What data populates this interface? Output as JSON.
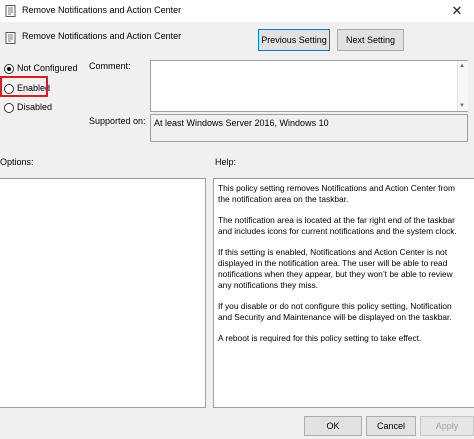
{
  "window": {
    "title": "Remove Notifications and Action Center",
    "close_glyph": "✕"
  },
  "policy": {
    "name": "Remove Notifications and Action Center",
    "icon": "policy-setting-icon"
  },
  "nav": {
    "previous_label": "Previous Setting",
    "next_label": "Next Setting"
  },
  "state": {
    "options": [
      {
        "label": "Not Configured",
        "selected": true
      },
      {
        "label": "Enabled",
        "selected": false,
        "highlighted": true
      },
      {
        "label": "Disabled",
        "selected": false
      }
    ],
    "highlight_color": "#d81b28"
  },
  "comment": {
    "label": "Comment:",
    "value": ""
  },
  "supported": {
    "label": "Supported on:",
    "value": "At least Windows Server 2016, Windows 10"
  },
  "options_panel": {
    "label": "Options:"
  },
  "help_panel": {
    "label": "Help:",
    "paragraphs": [
      "This policy setting removes Notifications and Action Center from the notification area on the taskbar.",
      "The notification area is located at the far right end of the taskbar and includes icons for current notifications and the system clock.",
      "If this setting is enabled, Notifications and Action Center is not displayed in the notification area. The user will be able to read notifications when they appear, but they won’t be able to review any notifications they miss.",
      "If you disable or do not configure this policy setting, Notification and Security and Maintenance will be displayed on the taskbar.",
      "A reboot is required for this policy setting to take effect."
    ]
  },
  "footer": {
    "ok_label": "OK",
    "cancel_label": "Cancel",
    "apply_label": "Apply"
  }
}
